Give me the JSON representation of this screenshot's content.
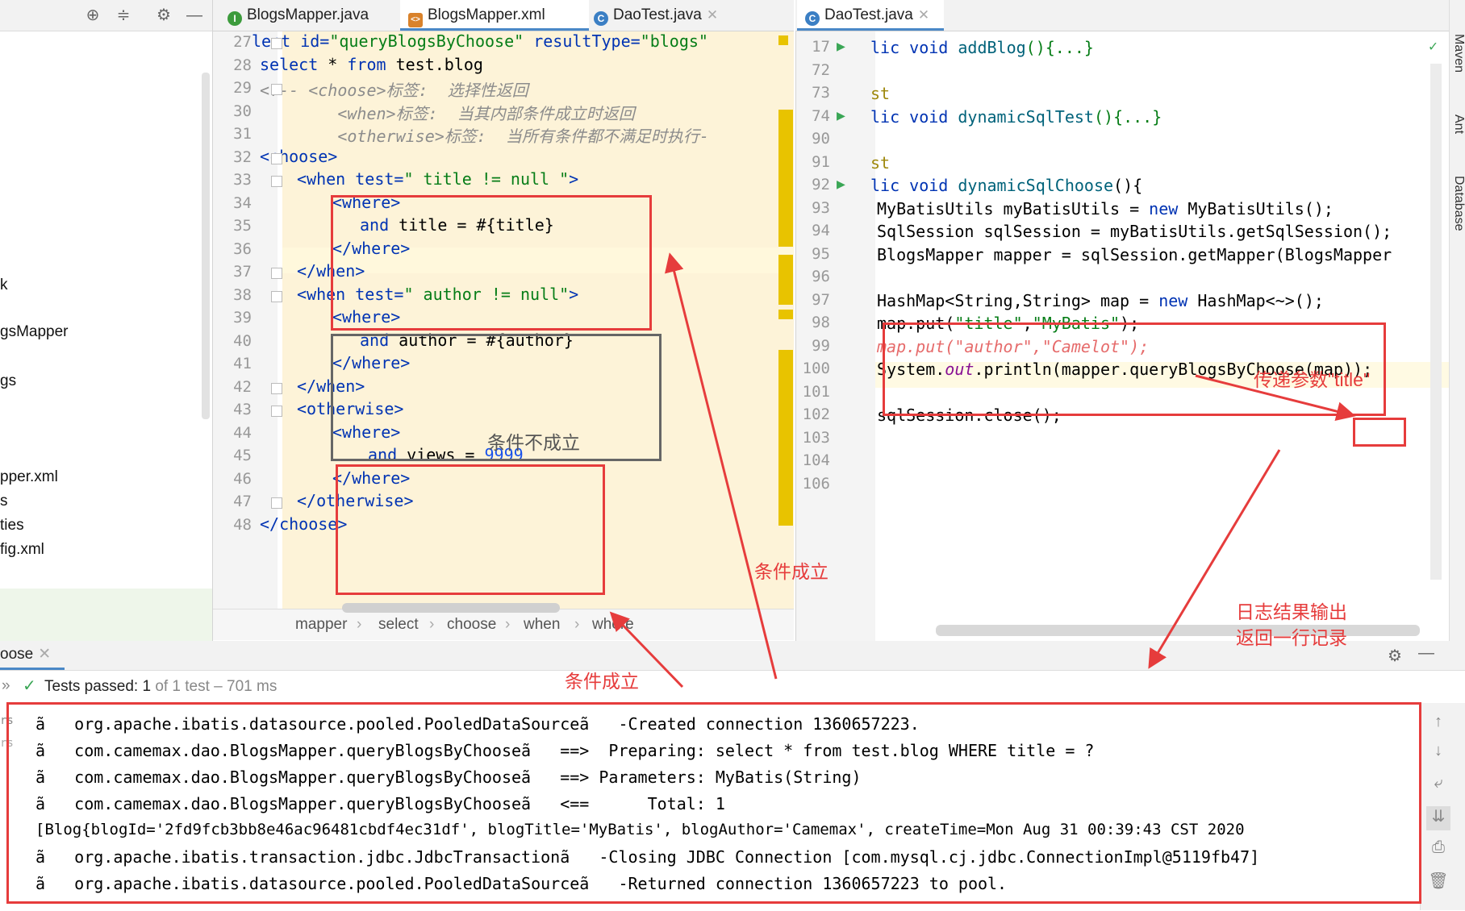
{
  "project_panel": {
    "items": [
      "k",
      "gsMapper",
      "gs",
      "pper.xml",
      "s",
      "ties",
      "fig.xml"
    ]
  },
  "xml_tabs": [
    {
      "label": "BlogsMapper.java",
      "icon": "I"
    },
    {
      "label": "BlogsMapper.xml",
      "icon": "<>"
    },
    {
      "label": "DaoTest.java",
      "icon": "C"
    }
  ],
  "java_tabs": [
    {
      "label": "DaoTest.java",
      "icon": "C"
    }
  ],
  "xml_editor": {
    "line_numbers": [
      "27",
      "28",
      "29",
      "30",
      "31",
      "32",
      "33",
      "34",
      "35",
      "36",
      "37",
      "38",
      "39",
      "40",
      "41",
      "42",
      "43",
      "44",
      "45",
      "46",
      "47",
      "48"
    ],
    "lines": {
      "l27a": "lect id=",
      "l27b": "\"queryBlogsByChoose\"",
      "l27c": " resultType=",
      "l27d": "\"blogs\"",
      "l28a": "select",
      "l28b": " * ",
      "l28c": "from",
      "l28d": " test.blog",
      "l29": "<!-- <choose>标签:  选择性返回",
      "l30": "        <when>标签:  当其内部条件成立时返回",
      "l31": "        <otherwise>标签:  当所有条件都不满足时执行-",
      "l32": "<choose>",
      "l33a": "<when ",
      "l33b": "test=",
      "l33c": "\" title != null \"",
      "l33d": ">",
      "l34": "<where>",
      "l35a": "and",
      "l35b": " title = #{title}",
      "l36": "</where>",
      "l37": "</when>",
      "l38a": "<when ",
      "l38b": "test=",
      "l38c": "\" author != null\"",
      "l38d": ">",
      "l39": "<where>",
      "l40a": "and",
      "l40b": " author = #{author}",
      "l41": "</where>",
      "l42": "</when>",
      "l43": "<otherwise>",
      "l44": "<where>",
      "l45a": "and",
      "l45b": " views = ",
      "l45c": "9999",
      "l46": "</where>",
      "l47": "</otherwise>",
      "l48": "</choose>"
    }
  },
  "breadcrumb": [
    "mapper",
    "select",
    "choose",
    "when",
    "where"
  ],
  "java_editor": {
    "line_numbers": [
      "17",
      "72",
      "73",
      "74",
      "90",
      "91",
      "92",
      "93",
      "94",
      "95",
      "96",
      "97",
      "98",
      "99",
      "100",
      "101",
      "102",
      "103",
      "104",
      "106"
    ],
    "lines": {
      "l17a": "lic void ",
      "l17b": "addBlog",
      "l17c": "(){...}",
      "l73": "st",
      "l74a": "lic void ",
      "l74b": "dynamicSqlTest",
      "l74c": "(){...}",
      "l91": "st",
      "l92a": "lic void ",
      "l92b": "dynamicSqlChoose",
      "l92c": "(){",
      "l93a": "MyBatisUtils myBatisUtils = ",
      "l93b": "new",
      "l93c": " MyBatisUtils();",
      "l94": "SqlSession sqlSession = myBatisUtils.getSqlSession();",
      "l95": "BlogsMapper mapper = sqlSession.getMapper(BlogsMapper",
      "l97a": "HashMap<String,String> map = ",
      "l97b": "new",
      "l97c": " HashMap<~>();",
      "l98a": "map.put(",
      "l98b": "\"title\"",
      "l98c": ",",
      "l98d": "\"MyBatis\"",
      "l98e": ");",
      "l99": "map.put(\"author\",\"Camelot\");",
      "l100a": "System.",
      "l100b": "out",
      "l100c": ".println(mapper.queryBlogsByChoose(map));",
      "l102": "sqlSession.close();"
    }
  },
  "run_panel": {
    "tab_label": "oose",
    "status_prefix": "Tests passed:",
    "status_count": "1",
    "status_suffix": "of 1 test – 701 ms",
    "gutter_labels": [
      "rs",
      "rs"
    ],
    "console_lines": [
      "ã   org.apache.ibatis.datasource.pooled.PooledDataSourceã   -Created connection 1360657223.",
      "ã   com.camemax.dao.BlogsMapper.queryBlogsByChooseã   ==>  Preparing: select * from test.blog WHERE title = ?",
      "ã   com.camemax.dao.BlogsMapper.queryBlogsByChooseã   ==> Parameters: MyBatis(String)",
      "ã   com.camemax.dao.BlogsMapper.queryBlogsByChooseã   <==      Total: 1",
      "[Blog{blogId='2fd9fcb3bb8e46ac96481cbdf4ec31df', blogTitle='MyBatis', blogAuthor='Camemax', createTime=Mon Aug 31 00:39:43 CST 2020",
      "ã   org.apache.ibatis.transaction.jdbc.JdbcTransactionã   -Closing JDBC Connection [com.mysql.cj.jdbc.ConnectionImpl@5119fb47]",
      "ã   org.apache.ibatis.datasource.pooled.PooledDataSourceã   -Returned connection 1360657223 to pool."
    ]
  },
  "right_strip": [
    "Maven",
    "Ant",
    "Database"
  ],
  "annotations": {
    "cond_fail": "条件不成立",
    "cond_ok_1": "条件成立",
    "cond_ok_2": "条件成立",
    "pass_param": "传递参数\"title\"",
    "log_1": "日志结果输出",
    "log_2": "返回一行记录"
  },
  "colors": {
    "annotation_red": "#e63c3c",
    "editor_bg": "#fdf3d8",
    "keyword": "#0033b3",
    "string": "#067d17"
  }
}
